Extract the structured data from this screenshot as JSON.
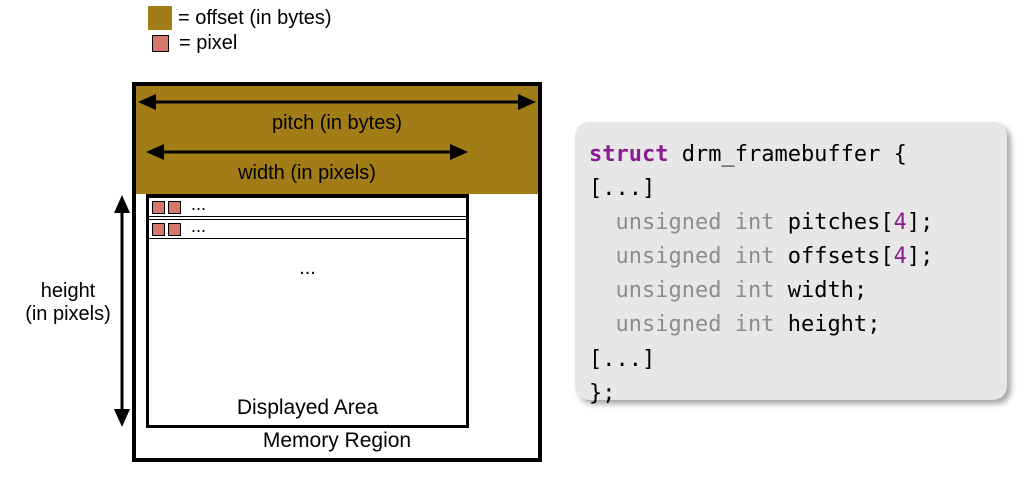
{
  "legend": {
    "offset_label": "= offset (in bytes)",
    "pixel_label": "= pixel"
  },
  "arrows": {
    "pitch_label": "pitch (in bytes)",
    "width_label": "width (in pixels)",
    "height_label_line1": "height",
    "height_label_line2": "(in pixels)"
  },
  "display": {
    "row_dots": "...",
    "body_dots": "...",
    "displayed_area": "Displayed Area",
    "memory_region": "Memory Region"
  },
  "code": {
    "kw_struct": "struct",
    "struct_name": "drm_framebuffer",
    "brace_open": "{",
    "ellipsis": "[...]",
    "type": "unsigned int",
    "field_pitches": "pitches",
    "field_offsets": "offsets",
    "field_width": "width",
    "field_height": "height",
    "arr_open": "[",
    "arr_close": "]",
    "arr_num": "4",
    "semi": ";",
    "brace_close_line": "};"
  }
}
